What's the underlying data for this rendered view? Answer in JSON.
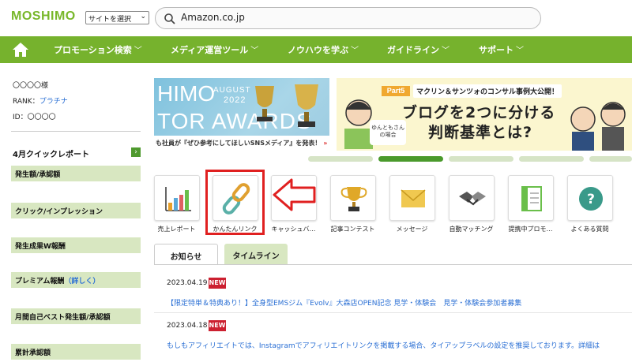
{
  "header": {
    "logo": "MOSHIMO",
    "site_select": "サイトを選択",
    "search_value": "Amazon.co.jp"
  },
  "nav": {
    "items": [
      {
        "label": "プロモーション検索"
      },
      {
        "label": "メディア運営ツール"
      },
      {
        "label": "ノウハウを学ぶ"
      },
      {
        "label": "ガイドライン"
      },
      {
        "label": "サポート"
      }
    ]
  },
  "user": {
    "name": "〇〇〇〇様",
    "rank_label": "RANK：",
    "rank_value": "プラチナ",
    "id_label": "ID：〇〇〇〇"
  },
  "quick_report": {
    "title": "4月クイックレポート",
    "arrow": "›",
    "sections": [
      {
        "label": "発生額/承認額"
      },
      {
        "label": "クリック/インプレッション"
      },
      {
        "label": "発生成果W報酬"
      },
      {
        "label": "プレミアム報酬",
        "link": "（詳しく）"
      },
      {
        "label": "月間自己ベスト発生額/承認額"
      },
      {
        "label": "累計承認額"
      }
    ]
  },
  "banners": {
    "left": {
      "month": "AUGUST",
      "year": "2022",
      "big1": "HIMO",
      "big2": "TOR AWARDS",
      "strip": "も社員が『ぜひ参考にしてほしいSNSメディア』を発表！",
      "strip_arrow": "»"
    },
    "right": {
      "part": "Part5",
      "consult": "マクリン＆サンツォのコンサル事例大公開！",
      "line1": "ブログを2つに分ける",
      "line2": "判断基準とは?",
      "bubble": "ゆんともさんの場合"
    }
  },
  "tiles": [
    {
      "label": "売上レポート",
      "icon": "bar-chart-icon"
    },
    {
      "label": "かんたんリンク",
      "icon": "chain-link-icon"
    },
    {
      "label": "キャッシュバ…",
      "icon": "cashback-icon"
    },
    {
      "label": "記事コンテスト",
      "icon": "trophy-icon"
    },
    {
      "label": "メッセージ",
      "icon": "envelope-icon"
    },
    {
      "label": "自動マッチング",
      "icon": "handshake-icon"
    },
    {
      "label": "提携中プロモ…",
      "icon": "promotion-book-icon"
    },
    {
      "label": "よくある質問",
      "icon": "question-icon"
    }
  ],
  "tabs": [
    {
      "label": "お知らせ"
    },
    {
      "label": "タイムライン"
    }
  ],
  "news": [
    {
      "date": "2023.04.19",
      "badge": "NEW",
      "text": "【限定特単＆特典あり！】全身型EMSジム『Evolv』大森店OPEN記念 見学・体験会　見学・体験会参加者募集"
    },
    {
      "date": "2023.04.18",
      "badge": "NEW",
      "text": "もしもアフィリエイトでは、Instagramでアフィリエイトリンクを掲載する場合、タイアップラベルの設定を推奨しております。詳細は"
    }
  ],
  "colors": {
    "brand_green": "#76b22d",
    "light_green": "#d8e7c1",
    "link_blue": "#2a6fd4",
    "badge_red": "#cc2030",
    "highlight_red": "#e02020"
  }
}
